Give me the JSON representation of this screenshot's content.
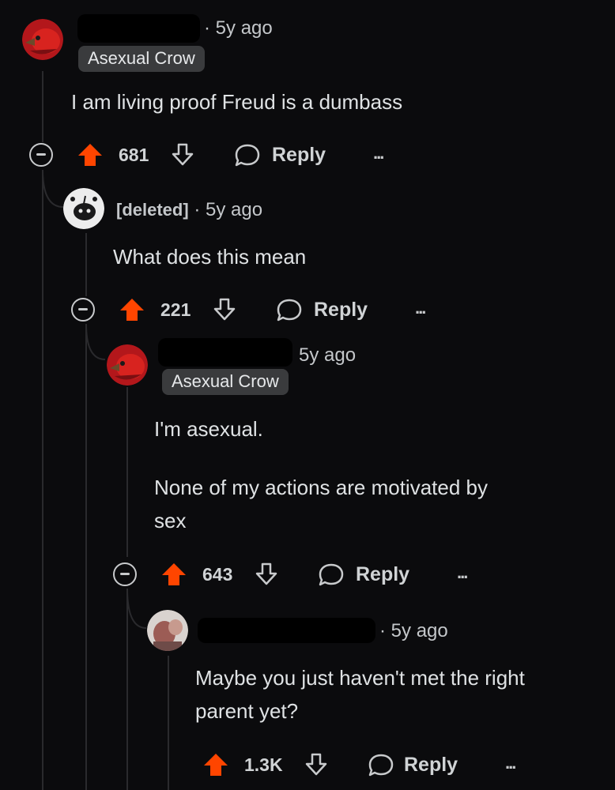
{
  "comments": [
    {
      "time": "5y ago",
      "flair": "Asexual Crow",
      "lines": [
        "I am living proof Freud is a dumbass"
      ],
      "votes": "681",
      "reply_label": "Reply",
      "more_label": "..."
    },
    {
      "username": "[deleted]",
      "time": "5y ago",
      "lines": [
        "What does this mean"
      ],
      "votes": "221",
      "reply_label": "Reply",
      "more_label": "..."
    },
    {
      "time": "5y ago",
      "flair": "Asexual Crow",
      "lines": [
        "I'm asexual.",
        "",
        "None of my actions are motivated by",
        "sex"
      ],
      "votes": "643",
      "reply_label": "Reply",
      "more_label": "..."
    },
    {
      "time": "5y ago",
      "lines": [
        "Maybe you just haven't met the right",
        "parent yet?"
      ],
      "votes": "1.3K",
      "reply_label": "Reply",
      "more_label": "..."
    }
  ],
  "colors": {
    "background": "#0b0b0d",
    "upvote": "#ff4500",
    "flair_bg": "#3a3b3d",
    "text": "#dfe2e4"
  },
  "icons": [
    "crow-avatar-icon",
    "deleted-user-avatar-icon",
    "user-photo-avatar-icon",
    "collapse-icon",
    "upvote-arrow-icon",
    "downvote-arrow-icon",
    "reply-bubble-icon",
    "more-options-icon"
  ]
}
